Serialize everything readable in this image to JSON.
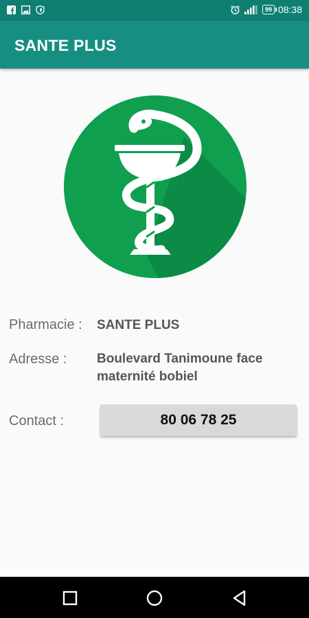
{
  "status_bar": {
    "time": "08:38",
    "battery": "99",
    "left_icons": [
      "facebook-icon",
      "image-icon",
      "shield-icon"
    ],
    "right_icons": [
      "alarm-icon",
      "signal-icon",
      "battery-icon"
    ]
  },
  "app_bar": {
    "title": "SANTE PLUS"
  },
  "logo": {
    "icon": "caduceus-icon",
    "background": "#0f9f4f"
  },
  "details": {
    "pharmacy_label": "Pharmacie :",
    "pharmacy_value": "SANTE PLUS",
    "address_label": "Adresse :",
    "address_line1": "Boulevard Tanimoune face",
    "address_line2": "maternité bobiel",
    "contact_label": "Contact :",
    "contact_value": "80 06 78 25"
  },
  "nav_bar": {
    "buttons": [
      "recents-icon",
      "home-icon",
      "back-icon"
    ]
  },
  "colors": {
    "status_bar": "#0f7f72",
    "app_bar": "#168f82",
    "logo_green": "#0f9f4f"
  }
}
